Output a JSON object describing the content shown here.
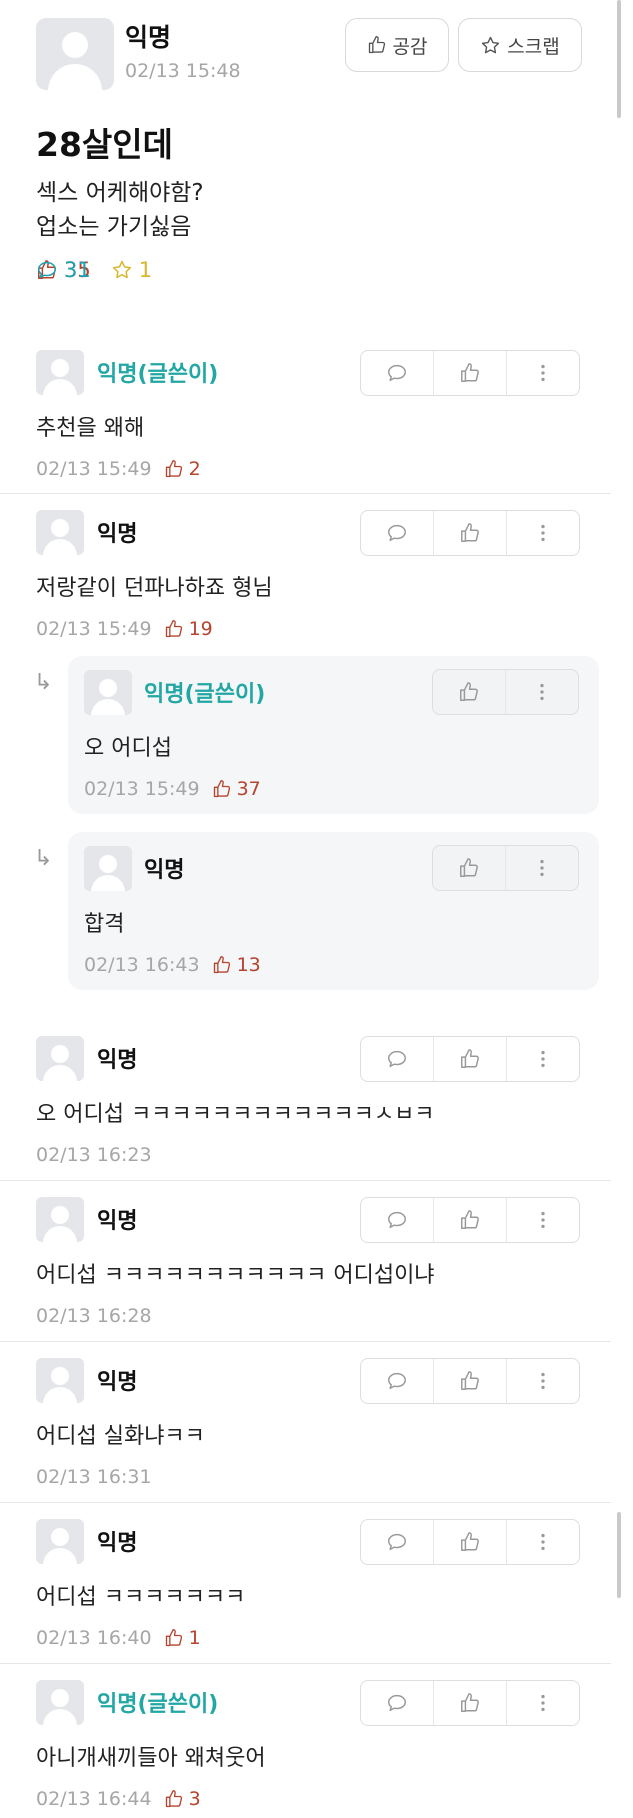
{
  "post": {
    "author": "익명",
    "time": "02/13 15:48",
    "like_button": "공감",
    "scrap_button": "스크랩",
    "title": "28살인데",
    "body_lines": [
      "섹스 어케해야함?",
      "업소는 가기싫음"
    ],
    "stats": {
      "likes": "35",
      "comments": "31",
      "scraps": "1"
    }
  },
  "comments": [
    {
      "author": "익명(글쓴이)",
      "text": "추천을 왜해",
      "time": "02/13 15:49",
      "likes": "2"
    },
    {
      "author": "익명",
      "text": "저랑같이 던파나하죠 형님",
      "time": "02/13 15:49",
      "likes": "19"
    },
    {
      "author": "익명(글쓴이)",
      "text": "오 어디섭",
      "time": "02/13 15:49",
      "likes": "37"
    },
    {
      "author": "익명",
      "text": "합격",
      "time": "02/13 16:43",
      "likes": "13"
    },
    {
      "author": "익명",
      "text": "오 어디섭 ㅋㅋㅋㅋㅋㅋㅋㅋㅋㅋㅋㅋㅅㅂㅋ",
      "time": "02/13 16:23",
      "likes": ""
    },
    {
      "author": "익명",
      "text": "어디섭 ㅋㅋㅋㅋㅋㅋㅋㅋㅋㅋㅋ 어디섭이냐",
      "time": "02/13 16:28",
      "likes": ""
    },
    {
      "author": "익명",
      "text": "어디섭 실화냐ㅋㅋ",
      "time": "02/13 16:31",
      "likes": ""
    },
    {
      "author": "익명",
      "text": "어디섭 ㅋㅋㅋㅋㅋㅋㅋ",
      "time": "02/13 16:40",
      "likes": "1"
    },
    {
      "author": "익명(글쓴이)",
      "text": "아니개새끼들아 왜쳐웃어",
      "time": "02/13 16:44",
      "likes": "3"
    }
  ],
  "reply_arrow": "↳",
  "icons": [
    "thumbs-up-icon",
    "star-icon",
    "comment-bubble-icon",
    "more-vertical-icon",
    "avatar-icon"
  ],
  "colors": {
    "like": "#b5432e",
    "comment": "#1aa1b5",
    "scrap": "#d8b62a",
    "op_author": "#22a7a4"
  }
}
